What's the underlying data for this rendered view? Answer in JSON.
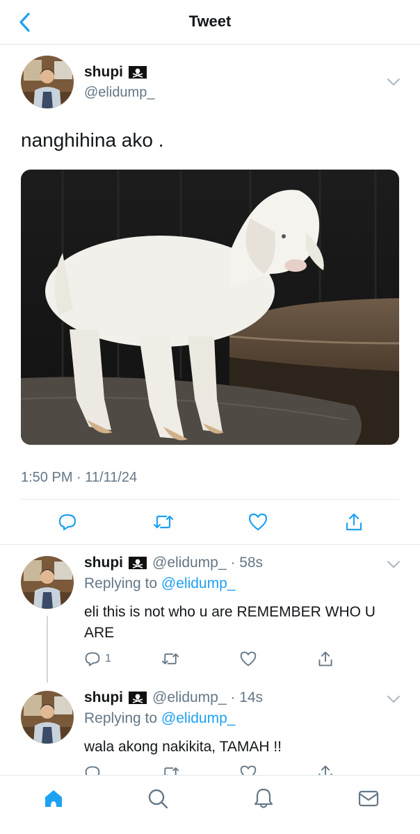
{
  "header": {
    "title": "Tweet",
    "back_icon": "chevron-left-icon"
  },
  "accent": "#1da1f2",
  "main_tweet": {
    "name": "shupi",
    "flag_icon": "pirate-flag-icon",
    "handle": "@elidump_",
    "text": "nanghihina ako .",
    "image_subject": "baby goat",
    "timestamp": "1:50 PM · 11/11/24",
    "actions": [
      "reply-icon",
      "retweet-icon",
      "like-icon",
      "share-icon"
    ]
  },
  "replies": [
    {
      "name": "shupi",
      "handle_time": "@elidump_ · 58s",
      "replying_prefix": "Replying to",
      "replying_to": "@elidump_",
      "text": "eli this is not who u are REMEMBER WHO U ARE",
      "reply_count": "1"
    },
    {
      "name": "shupi",
      "handle_time": "@elidump_ · 14s",
      "replying_prefix": "Replying to",
      "replying_to": "@elidump_",
      "text": "wala akong nakikita, TAMAH !!",
      "reply_count": ""
    }
  ],
  "tabbar": [
    "home-icon",
    "search-icon",
    "notifications-icon",
    "messages-icon"
  ]
}
